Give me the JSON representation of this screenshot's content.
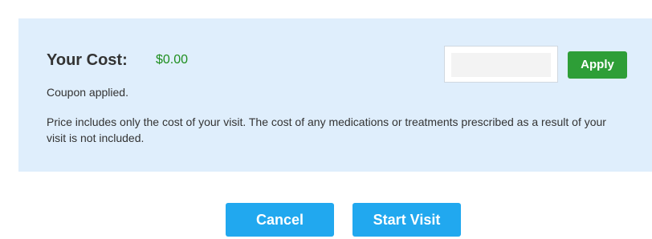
{
  "cost": {
    "label": "Your Cost:",
    "amount": "$0.00",
    "status": "Coupon applied.",
    "disclaimer": "Price includes only the cost of your visit. The cost of any medications or treatments prescribed as a result of your visit is not included."
  },
  "coupon": {
    "value": "",
    "placeholder": "",
    "apply_label": "Apply"
  },
  "actions": {
    "cancel_label": "Cancel",
    "start_label": "Start Visit"
  },
  "colors": {
    "panel_background": "#dfeefc",
    "cost_amount": "#1e8e1e",
    "apply_button": "#2e9e37",
    "action_button": "#21a8ef"
  }
}
